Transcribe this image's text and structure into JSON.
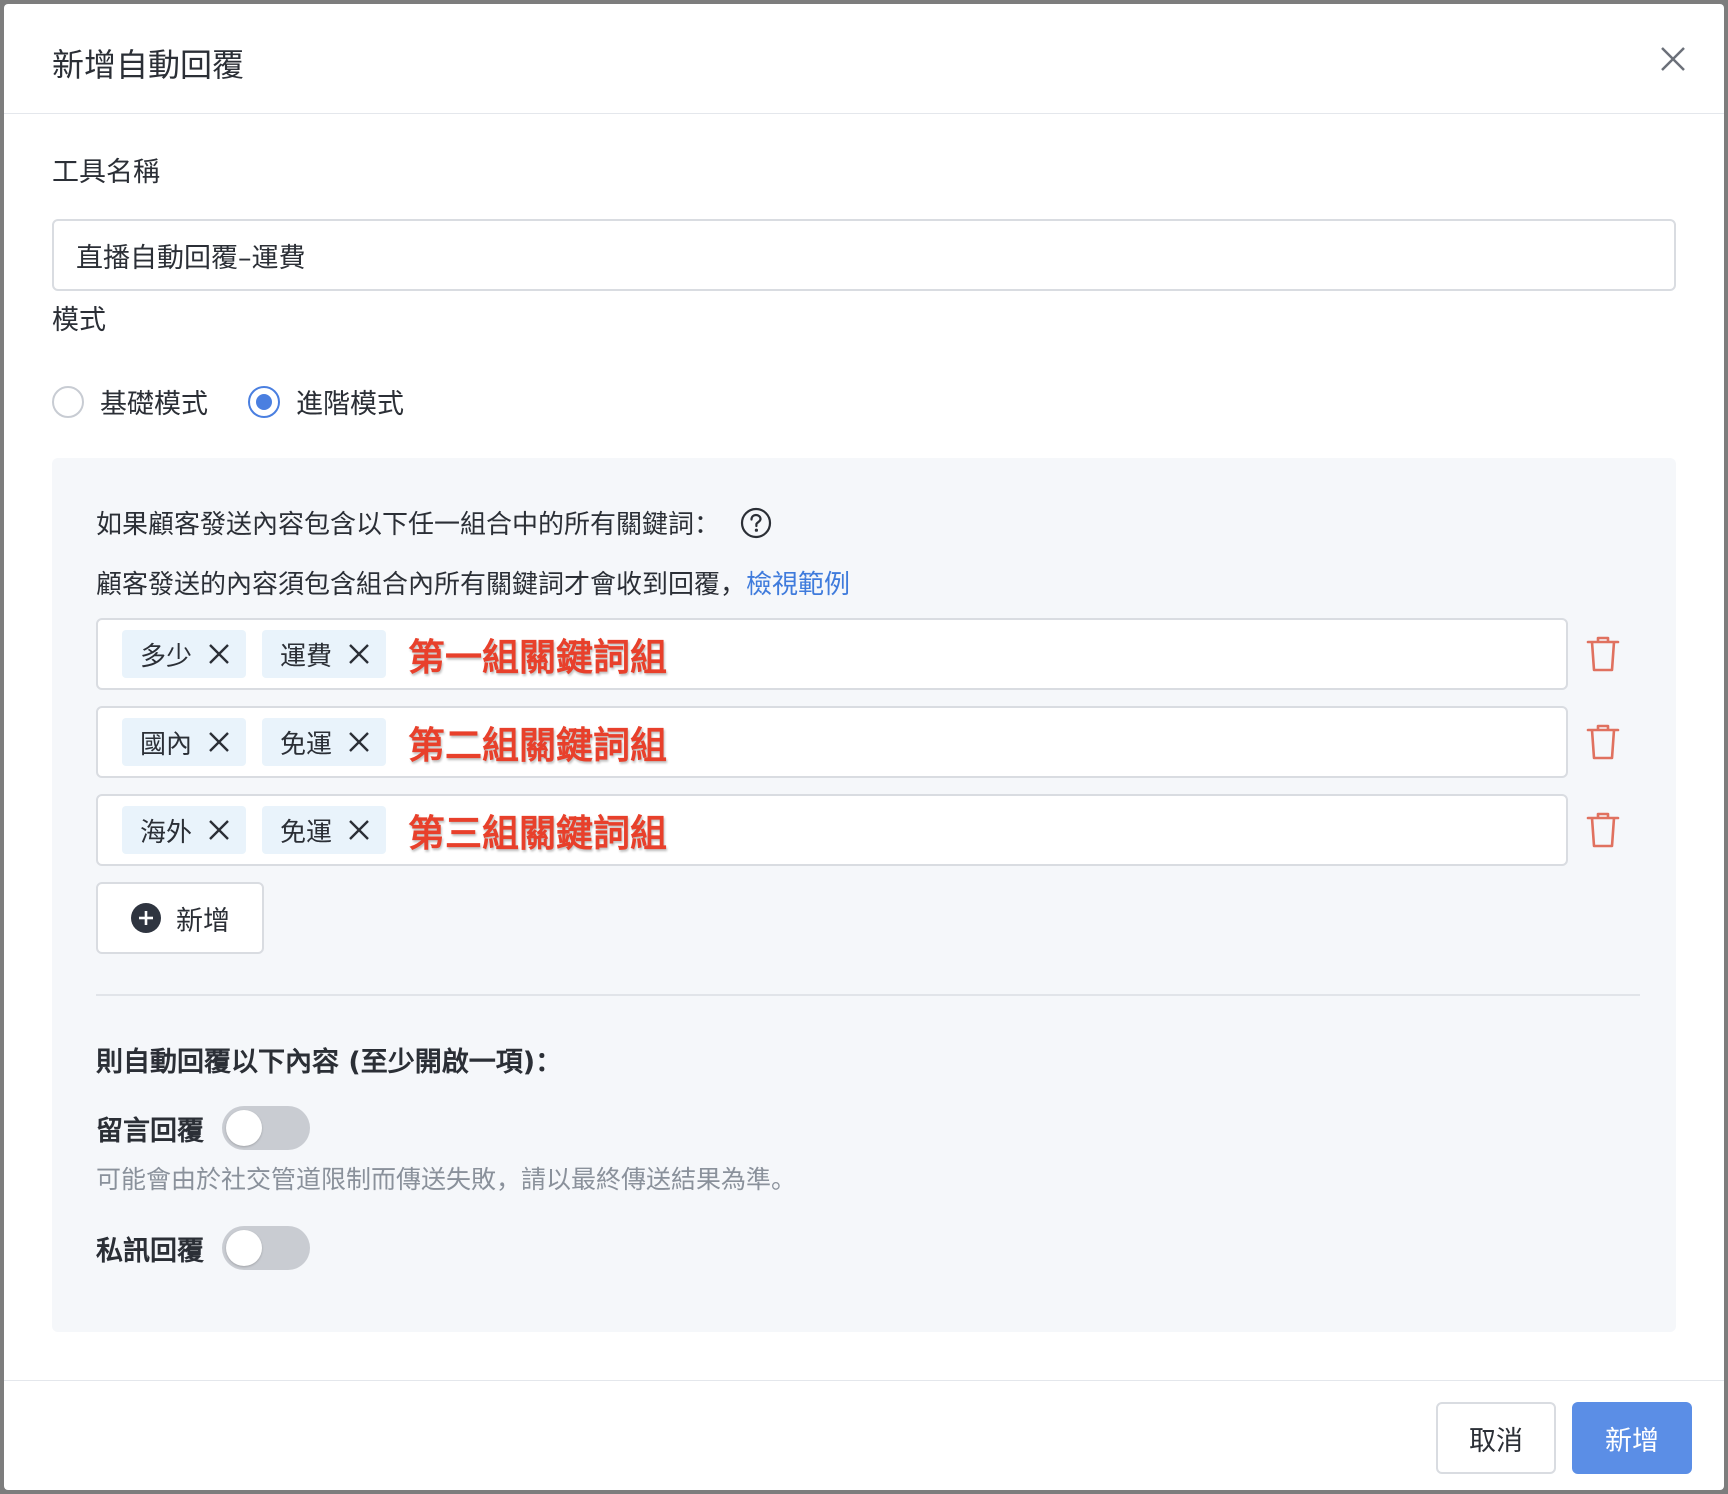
{
  "modal": {
    "title": "新增自動回覆"
  },
  "tool_name": {
    "label": "工具名稱",
    "value": "直播自動回覆–運費"
  },
  "mode": {
    "label": "模式",
    "options": [
      {
        "label": "基礎模式",
        "selected": false
      },
      {
        "label": "進階模式",
        "selected": true
      }
    ]
  },
  "keywords": {
    "intro": "如果顧客發送內容包含以下任一組合中的所有關鍵詞：",
    "description": "顧客發送的內容須包含組合內所有關鍵詞才會收到回覆，",
    "example_link": "檢視範例",
    "groups": [
      {
        "tags": [
          "多少",
          "運費"
        ],
        "annotation": "第一組關鍵詞組"
      },
      {
        "tags": [
          "國內",
          "免運"
        ],
        "annotation": "第二組關鍵詞組"
      },
      {
        "tags": [
          "海外",
          "免運"
        ],
        "annotation": "第三組關鍵詞組"
      }
    ],
    "add_label": "新增"
  },
  "replies": {
    "title": "則自動回覆以下內容 (至少開啟一項)：",
    "comment_reply": {
      "label": "留言回覆",
      "enabled": false
    },
    "comment_hint": "可能會由於社交管道限制而傳送失敗，請以最終傳送結果為準。",
    "dm_reply": {
      "label": "私訊回覆",
      "enabled": false
    }
  },
  "footer": {
    "cancel_label": "取消",
    "submit_label": "新增"
  },
  "colors": {
    "accent": "#4a7fe0",
    "primary_button": "#5b8ee6",
    "annotation": "#e8402b",
    "trash": "#e0715f",
    "tag_bg": "#e9f3fb"
  }
}
